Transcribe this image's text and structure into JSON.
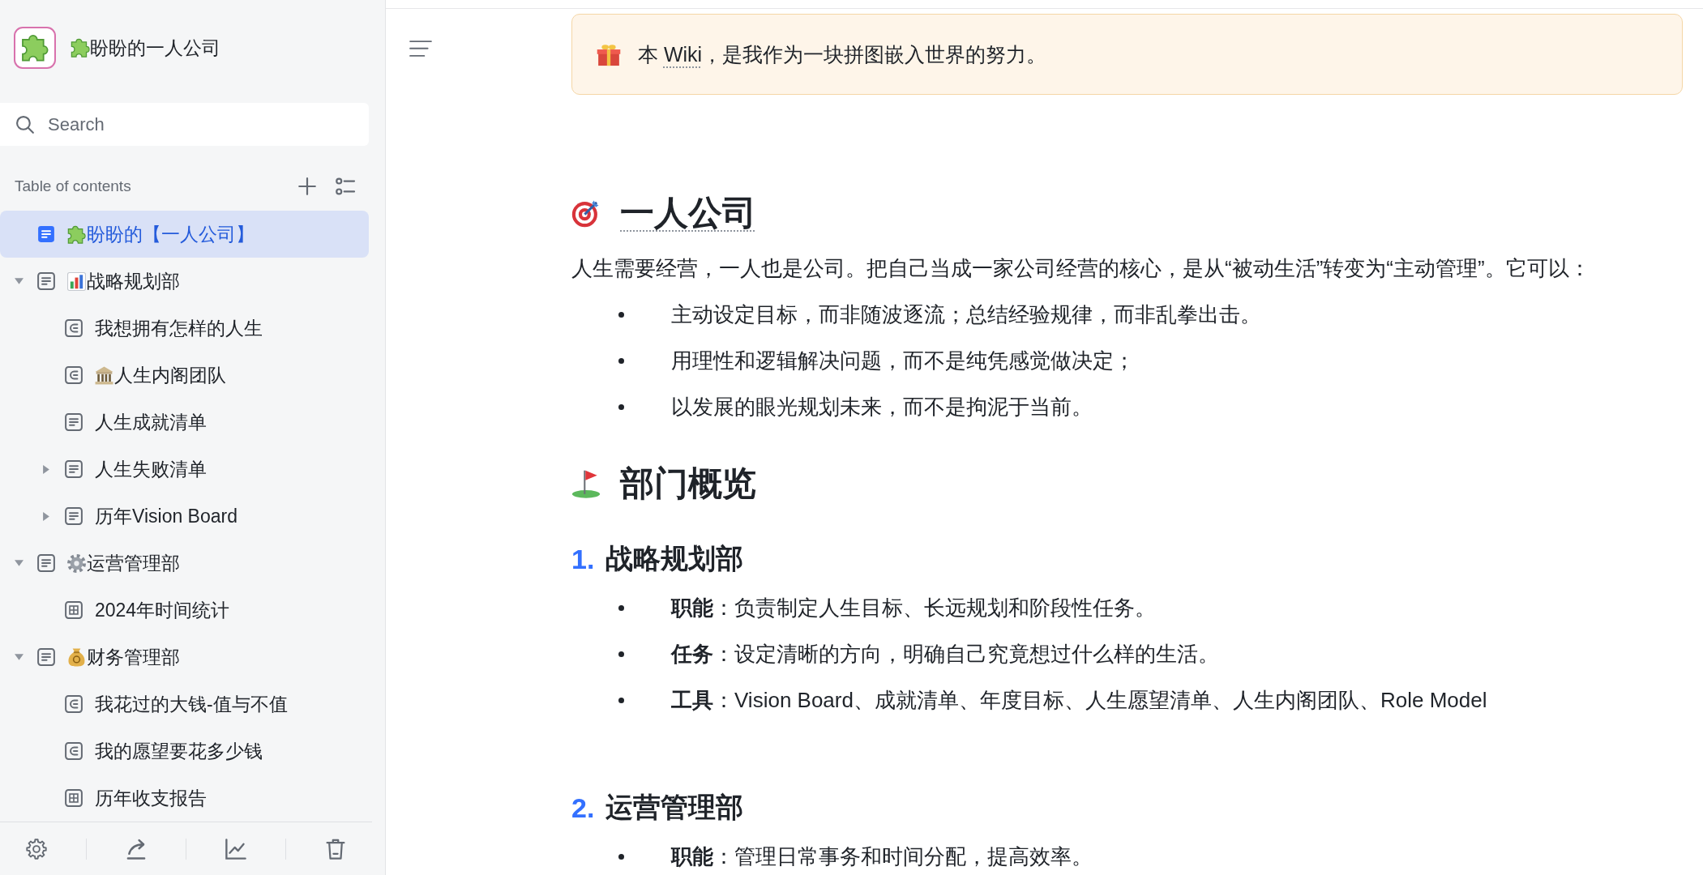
{
  "sidebar": {
    "title": "盼盼的一人公司",
    "search": {
      "placeholder": "Search"
    },
    "toc_label": "Table of contents",
    "tree": [
      {
        "label": "盼盼的【一人公司】",
        "kind": "doc",
        "selected": true
      },
      {
        "label": "战略规划部",
        "kind": "doc",
        "selected": false,
        "expanded": true,
        "children": [
          {
            "label": "我想拥有怎样的人生",
            "kind": "mindnote",
            "selected": false
          },
          {
            "label": "人生内阁团队",
            "kind": "mindnote",
            "selected": false
          },
          {
            "label": "人生成就清单",
            "kind": "doc",
            "selected": false
          },
          {
            "label": "人生失败清单",
            "kind": "doc",
            "selected": false,
            "expanded": false
          },
          {
            "label": "历年Vision Board",
            "kind": "doc",
            "selected": false,
            "expanded": false
          }
        ]
      },
      {
        "label": "运营管理部",
        "kind": "doc",
        "selected": false,
        "expanded": true,
        "children": [
          {
            "label": "2024年时间统计",
            "kind": "sheet",
            "selected": false
          }
        ]
      },
      {
        "label": "财务管理部",
        "kind": "doc",
        "selected": false,
        "expanded": true,
        "children": [
          {
            "label": "我花过的大钱-值与不值",
            "kind": "mindnote",
            "selected": false
          },
          {
            "label": "我的愿望要花多少钱",
            "kind": "mindnote",
            "selected": false
          },
          {
            "label": "历年收支报告",
            "kind": "sheet",
            "selected": false
          }
        ]
      }
    ]
  },
  "document": {
    "callout": {
      "segments": [
        {
          "kind": "text",
          "text": "本 "
        },
        {
          "kind": "term",
          "text": "Wiki"
        },
        {
          "kind": "text",
          "text": "，是我作为一块拼图嵌入世界的努力。"
        }
      ]
    },
    "blocks": [
      {
        "kind": "heading1",
        "text": "一人公司",
        "term": true
      },
      {
        "kind": "paragraph",
        "text": "人生需要经营，一人也是公司。把自己当成一家公司经营的核心，是从“被动生活”转变为“主动管理”。它可以："
      },
      {
        "kind": "bullet",
        "text": "主动设定目标，而非随波逐流；总结经验规律，而非乱拳出击。"
      },
      {
        "kind": "bullet",
        "text": "用理性和逻辑解决问题，而不是纯凭感觉做决定；"
      },
      {
        "kind": "bullet",
        "text": "以发展的眼光规划未来，而不是拘泥于当前。"
      },
      {
        "kind": "heading1",
        "text": "部门概览",
        "term": false
      },
      {
        "kind": "heading3",
        "number": "1.",
        "text": "战略规划部"
      },
      {
        "kind": "bullet",
        "text": "**职能**：负责制定人生目标、长远规划和阶段性任务。"
      },
      {
        "kind": "bullet",
        "text": "**任务**：设定清晰的方向，明确自己究竟想过什么样的生活。"
      },
      {
        "kind": "bullet",
        "text": "**工具**：Vision Board、成就清单、年度目标、人生愿望清单、人生内阁团队、Role Model"
      },
      {
        "kind": "heading3",
        "number": "2.",
        "text": "运营管理部"
      },
      {
        "kind": "bullet",
        "text": "**职能**：管理日常事务和时间分配，提高效率。"
      }
    ]
  }
}
